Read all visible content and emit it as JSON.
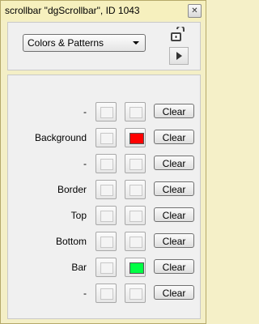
{
  "window": {
    "title": "scrollbar \"dgScrollbar\", ID 1043",
    "close_glyph": "✕"
  },
  "toolbar": {
    "dropdown_value": "Colors & Patterns",
    "lock_icon": "unlocked-padlock-icon",
    "play_icon": "play-triangle-icon"
  },
  "colors": {
    "red": "#ff0000",
    "green": "#00ff44"
  },
  "rows": [
    {
      "label": "-",
      "fore": null,
      "back": null,
      "clear": "Clear"
    },
    {
      "label": "Background",
      "fore": null,
      "back": "#ff0000",
      "clear": "Clear"
    },
    {
      "label": "-",
      "fore": null,
      "back": null,
      "clear": "Clear"
    },
    {
      "label": "Border",
      "fore": null,
      "back": null,
      "clear": "Clear"
    },
    {
      "label": "Top",
      "fore": null,
      "back": null,
      "clear": "Clear"
    },
    {
      "label": "Bottom",
      "fore": null,
      "back": null,
      "clear": "Clear"
    },
    {
      "label": "Bar",
      "fore": null,
      "back": "#00ff44",
      "clear": "Clear"
    },
    {
      "label": "-",
      "fore": null,
      "back": null,
      "clear": "Clear"
    }
  ]
}
